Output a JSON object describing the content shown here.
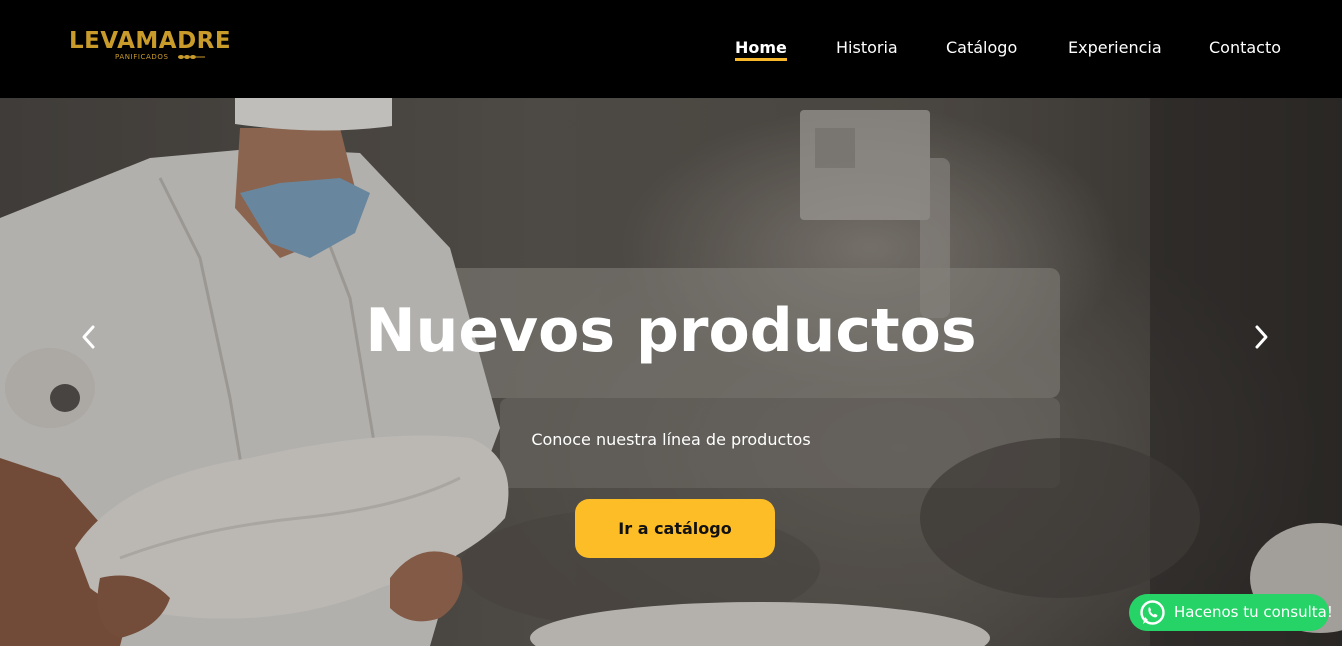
{
  "brand": {
    "name": "LEVAMADRE",
    "tagline": "PANIFICADOS",
    "color": "#c99b2b"
  },
  "nav": {
    "items": [
      {
        "label": "Home",
        "active": true
      },
      {
        "label": "Historia",
        "active": false
      },
      {
        "label": "Catálogo",
        "active": false
      },
      {
        "label": "Experiencia",
        "active": false
      },
      {
        "label": "Contacto",
        "active": false
      }
    ],
    "active_underline_color": "#f8b62a"
  },
  "hero": {
    "title": "Nuevos productos",
    "subtitle": "Conoce nuestra línea de productos",
    "cta_label": "Ir a catálogo",
    "cta_color": "#fdbd26",
    "prev_icon": "chevron-left-icon",
    "next_icon": "chevron-right-icon"
  },
  "whatsapp": {
    "label": "Hacenos tu consulta!",
    "icon": "whatsapp-icon",
    "color": "#25d366"
  }
}
